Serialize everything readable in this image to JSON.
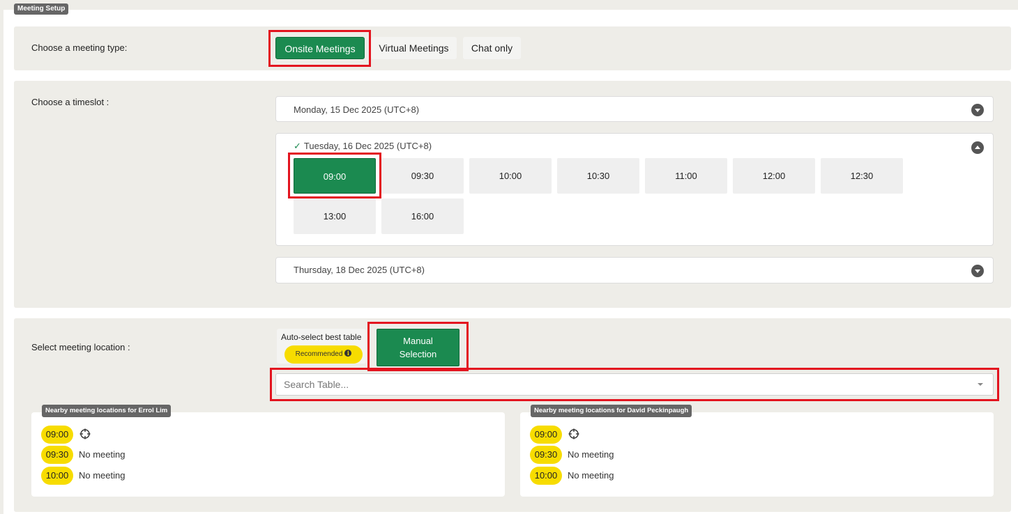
{
  "meeting_setup": {
    "tag": "Meeting Setup"
  },
  "meeting_type": {
    "label": "Choose a meeting type:",
    "options": [
      {
        "label": "Onsite Meetings",
        "selected": true
      },
      {
        "label": "Virtual Meetings",
        "selected": false
      },
      {
        "label": "Chat only",
        "selected": false
      }
    ]
  },
  "timeslot": {
    "label": "Choose a timeslot :",
    "days": [
      {
        "label": "Monday, 15 Dec 2025 (UTC+8)",
        "expanded": false
      },
      {
        "label": "Tuesday, 16 Dec 2025 (UTC+8)",
        "expanded": true,
        "checked": true,
        "slots": [
          "09:00",
          "09:30",
          "10:00",
          "10:30",
          "11:00",
          "12:00",
          "12:30",
          "13:00",
          "16:00"
        ],
        "selected_slot": "09:00"
      },
      {
        "label": "Thursday, 18 Dec 2025 (UTC+8)",
        "expanded": false
      }
    ]
  },
  "location": {
    "label": "Select meeting location :",
    "auto_select_label": "Auto-select best table",
    "recommended_label": "Recommended",
    "info_glyph": "i",
    "manual_label_line1": "Manual",
    "manual_label_line2": "Selection",
    "search_placeholder": "Search Table...",
    "search_value": ""
  },
  "nearby": [
    {
      "title": "Nearby meeting locations for Errol Lim",
      "rows": [
        {
          "time": "09:00",
          "status": ""
        },
        {
          "time": "09:30",
          "status": "No meeting"
        },
        {
          "time": "10:00",
          "status": "No meeting"
        }
      ]
    },
    {
      "title": "Nearby meeting locations for David Peckinpaugh",
      "rows": [
        {
          "time": "09:00",
          "status": ""
        },
        {
          "time": "09:30",
          "status": "No meeting"
        },
        {
          "time": "10:00",
          "status": "No meeting"
        }
      ]
    }
  ],
  "colors": {
    "accent_green": "#1b8a50",
    "highlight_red": "#e3141f",
    "badge_yellow": "#f7dc00",
    "panel_bg": "#eeede8"
  },
  "icons": {
    "expand": "chevron-down-icon",
    "collapse": "chevron-up-icon",
    "selected_day": "checkmark-icon",
    "locate": "crosshair-icon",
    "info": "info-icon",
    "dropdown": "caret-down-icon"
  }
}
